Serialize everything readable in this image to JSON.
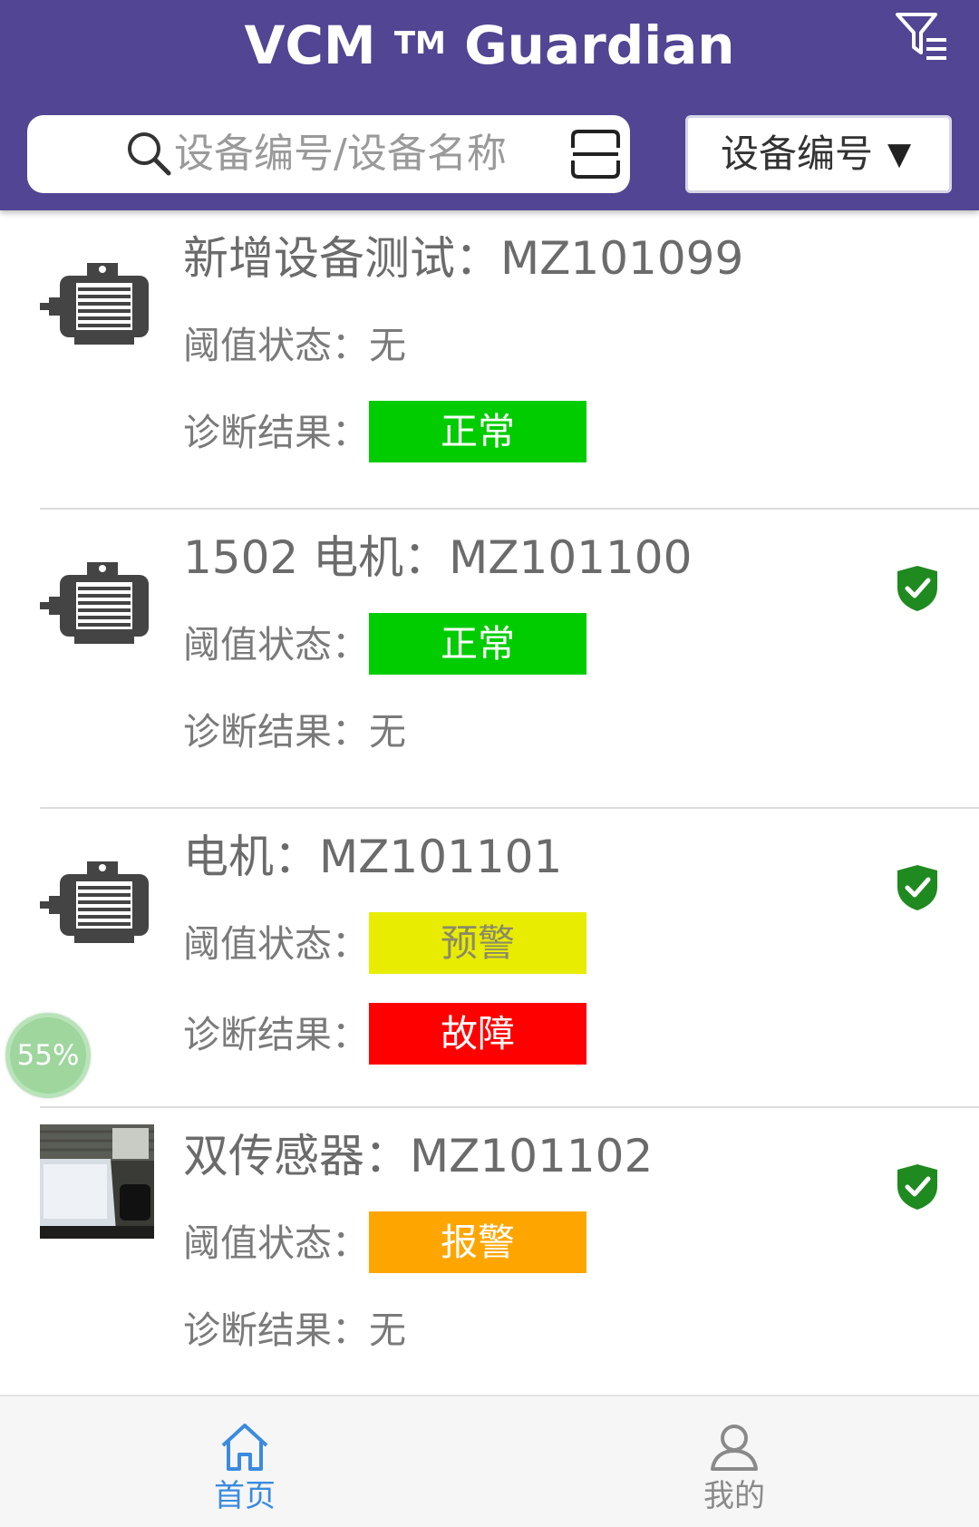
{
  "header": {
    "app_name": "VCM",
    "tm": "TM",
    "app_suffix": "Guardian",
    "search_placeholder": "设备编号/设备名称",
    "select_value": "设备编号",
    "select_caret": "▼"
  },
  "devices": [
    {
      "title": "新增设备测试：MZ101099",
      "threshold_label": "阈值状态：",
      "threshold_value": "无",
      "diagnosis_label": "诊断结果：",
      "diagnosis_value": "正常",
      "verified": false,
      "thumb": "motor-icon"
    },
    {
      "title": "1502 电机：MZ101100",
      "threshold_label": "阈值状态：",
      "threshold_value": "正常",
      "diagnosis_label": "诊断结果：",
      "diagnosis_value": "无",
      "verified": true,
      "thumb": "motor-icon"
    },
    {
      "title": "电机：MZ101101",
      "threshold_label": "阈值状态：",
      "threshold_value": "预警",
      "diagnosis_label": "诊断结果：",
      "diagnosis_value": "故障",
      "verified": true,
      "thumb": "motor-icon"
    },
    {
      "title": "双传感器：MZ101102",
      "threshold_label": "阈值状态：",
      "threshold_value": "报警",
      "diagnosis_label": "诊断结果：",
      "diagnosis_value": "无",
      "verified": true,
      "thumb": "device-photo"
    }
  ],
  "colors": {
    "header_bg": "#524593",
    "normal": "#00cc00",
    "warning": "#e8ec00",
    "alarm": "#ffa500",
    "fault": "#ff0000",
    "nav_active": "#3a8be0",
    "nav_inactive": "#8a8a8a",
    "shield": "#1f8a1f"
  },
  "progress_overlay": "55%",
  "bottom_nav": [
    {
      "label": "首页",
      "icon": "home-icon",
      "active": true
    },
    {
      "label": "我的",
      "icon": "user-icon",
      "active": false
    }
  ]
}
